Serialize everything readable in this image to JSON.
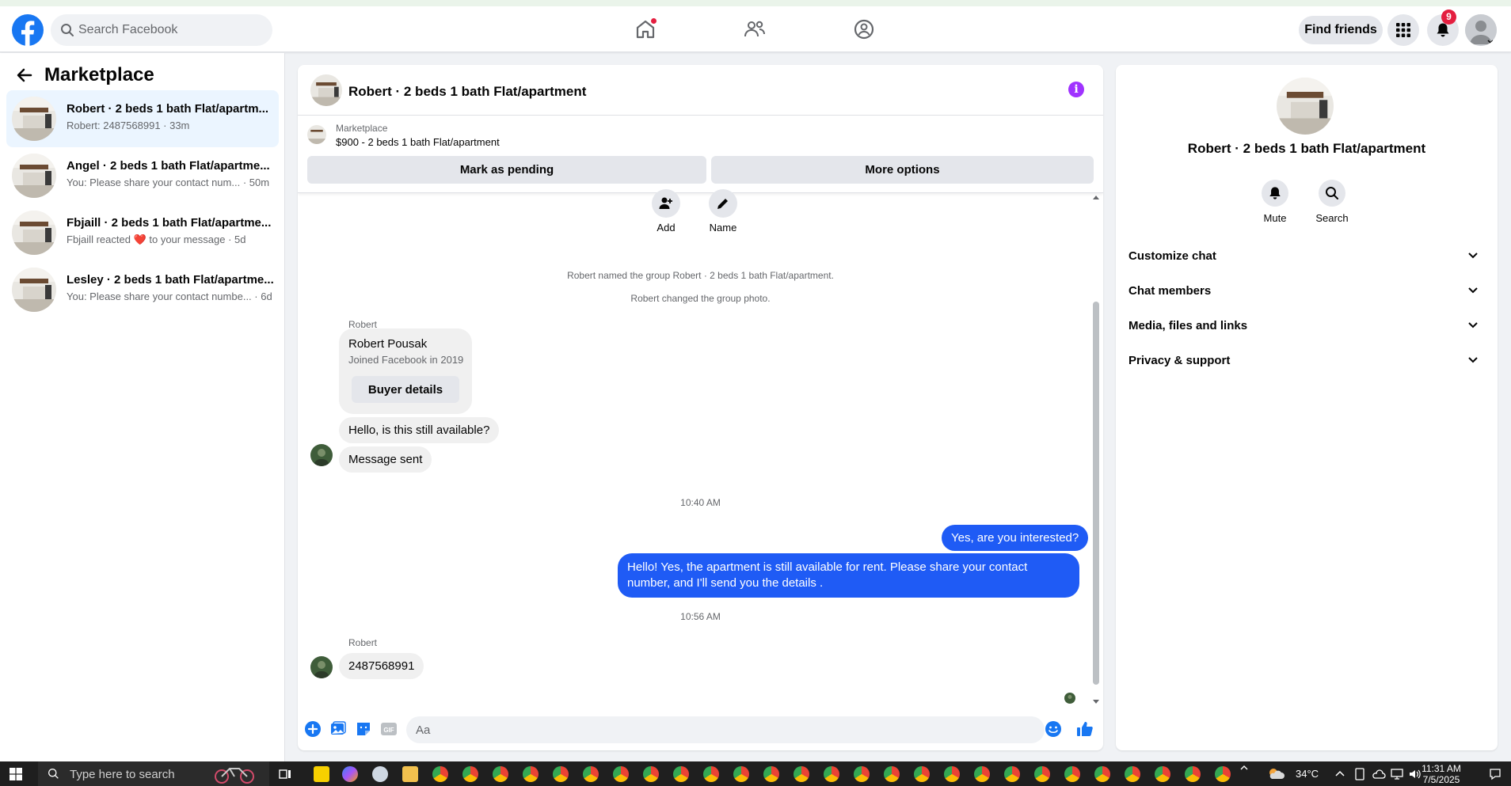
{
  "header": {
    "search_placeholder": "Search Facebook",
    "find_friends": "Find friends",
    "notifications_count": "9"
  },
  "sidebar": {
    "title": "Marketplace",
    "conversations": [
      {
        "title": "Robert · 2 beds 1 bath Flat/apartm...",
        "subtitle": "Robert: 2487568991 · 33m",
        "active": true
      },
      {
        "title": "Angel · 2 beds 1 bath Flat/apartme...",
        "subtitle": "You: Please share your contact num... · 50m",
        "active": false
      },
      {
        "title": "Fbjaill · 2 beds 1 bath Flat/apartme...",
        "subtitle_a": "Fbjaill reacted",
        "subtitle_b": "to your message · 5d",
        "active": false
      },
      {
        "title": "Lesley · 2 beds 1 bath Flat/apartme...",
        "subtitle": "You: Please share your contact numbe... · 6d",
        "active": false
      }
    ]
  },
  "chat": {
    "title": "Robert · 2 beds 1 bath Flat/apartment",
    "listing": {
      "category": "Marketplace",
      "price_title": "$900 - 2 beds 1 bath Flat/apartment",
      "mark_pending": "Mark as pending",
      "more_options": "More options"
    },
    "actions": {
      "add": "Add",
      "name": "Name"
    },
    "system_messages": [
      "Robert named the group Robert · 2 beds 1 bath Flat/apartment.",
      "Robert changed the group photo."
    ],
    "sender_name": "Robert",
    "profile_card": {
      "name": "Robert Pousak",
      "joined": "Joined Facebook in 2019",
      "button": "Buyer details"
    },
    "incoming_1": "Hello, is this still available?",
    "incoming_2": "Message sent",
    "time_1": "10:40 AM",
    "outgoing_1": "Yes, are you interested?",
    "outgoing_2": "Hello! Yes, the apartment is still available for rent. Please share your contact number, and I'll send you the details .",
    "time_2": "10:56 AM",
    "sender_name_2": "Robert",
    "incoming_3": "2487568991",
    "composer_placeholder": "Aa"
  },
  "right_panel": {
    "title": "Robert · 2 beds 1 bath Flat/apartment",
    "mute": "Mute",
    "search": "Search",
    "sections": [
      "Customize chat",
      "Chat members",
      "Media, files and links",
      "Privacy & support"
    ]
  },
  "taskbar": {
    "search_text": "Type here to search",
    "weather": "34°C",
    "time": "11:31 AM",
    "date": "7/5/2025"
  },
  "colors": {
    "brand": "#1877f2",
    "outgoing_bubble": "#1f5bf5",
    "info": "#a033ff",
    "notification": "#e41e3f"
  }
}
